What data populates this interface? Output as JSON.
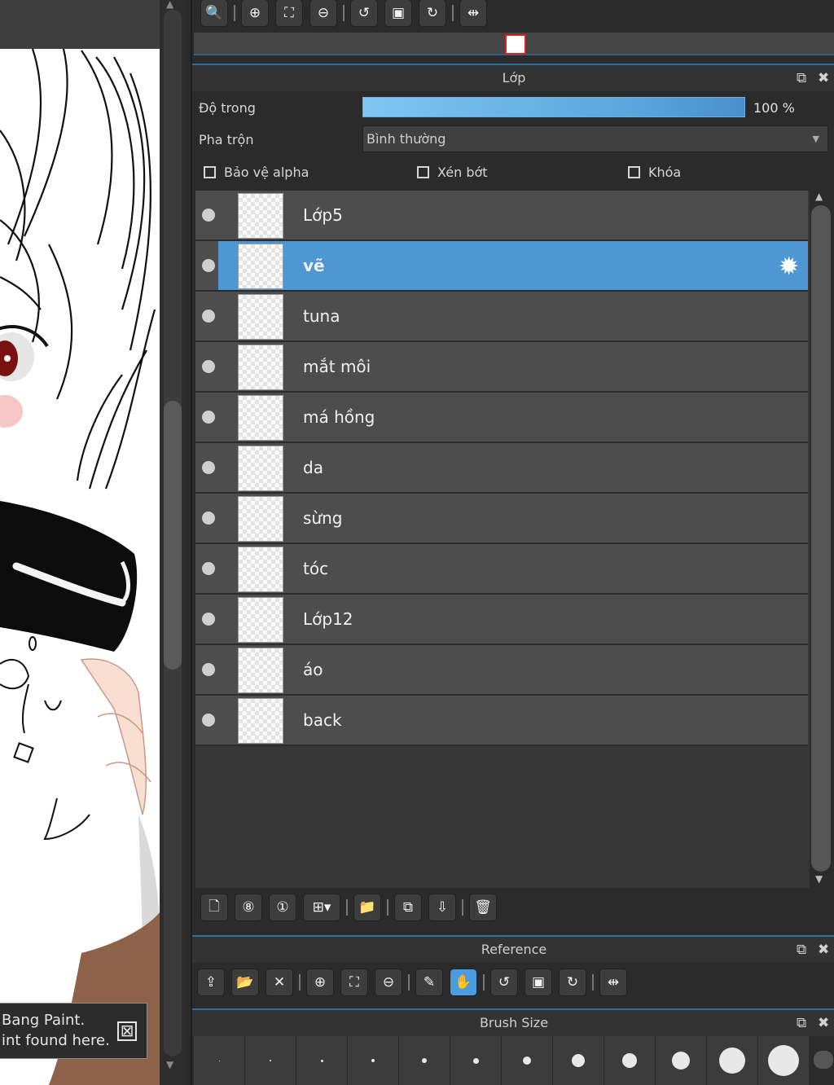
{
  "notification": {
    "line1": "Bang Paint.",
    "line2": "int found here.",
    "close": "⊠"
  },
  "navigator": {
    "toolbar": [
      "zoom-in-icon",
      "zoom-in-icon",
      "fit-screen-icon",
      "zoom-out-icon",
      "rotate-left-icon",
      "actual-size-icon",
      "rotate-right-icon",
      "flip-horizontal-icon"
    ]
  },
  "layer_panel": {
    "title": "Lớp",
    "opacity_label": "Độ trong",
    "opacity_value": "100 %",
    "opacity_level": 1.0,
    "blend_label": "Pha trộn",
    "blend_value": "Bình thường",
    "checkboxes": {
      "alpha": "Bảo vệ alpha",
      "clip": "Xén bớt",
      "lock": "Khóa"
    },
    "layers": [
      {
        "name": "Lớp5",
        "selected": false
      },
      {
        "name": "vẽ",
        "selected": true
      },
      {
        "name": "tuna",
        "selected": false
      },
      {
        "name": "mắt môi",
        "selected": false
      },
      {
        "name": "má hồng",
        "selected": false
      },
      {
        "name": "da",
        "selected": false
      },
      {
        "name": "sừng",
        "selected": false
      },
      {
        "name": "tóc",
        "selected": false
      },
      {
        "name": "Lớp12",
        "selected": false
      },
      {
        "name": "áo",
        "selected": false
      },
      {
        "name": "back",
        "selected": false
      }
    ]
  },
  "reference_panel": {
    "title": "Reference"
  },
  "brush_size_panel": {
    "title": "Brush Size",
    "sizes": [
      1,
      2,
      3,
      4,
      6,
      7,
      10,
      16,
      18,
      22,
      32,
      38
    ]
  },
  "colors": {
    "accent": "#4f97d3",
    "panel_bg": "#2b2b2b",
    "layer_bg": "#4d4d4d"
  }
}
